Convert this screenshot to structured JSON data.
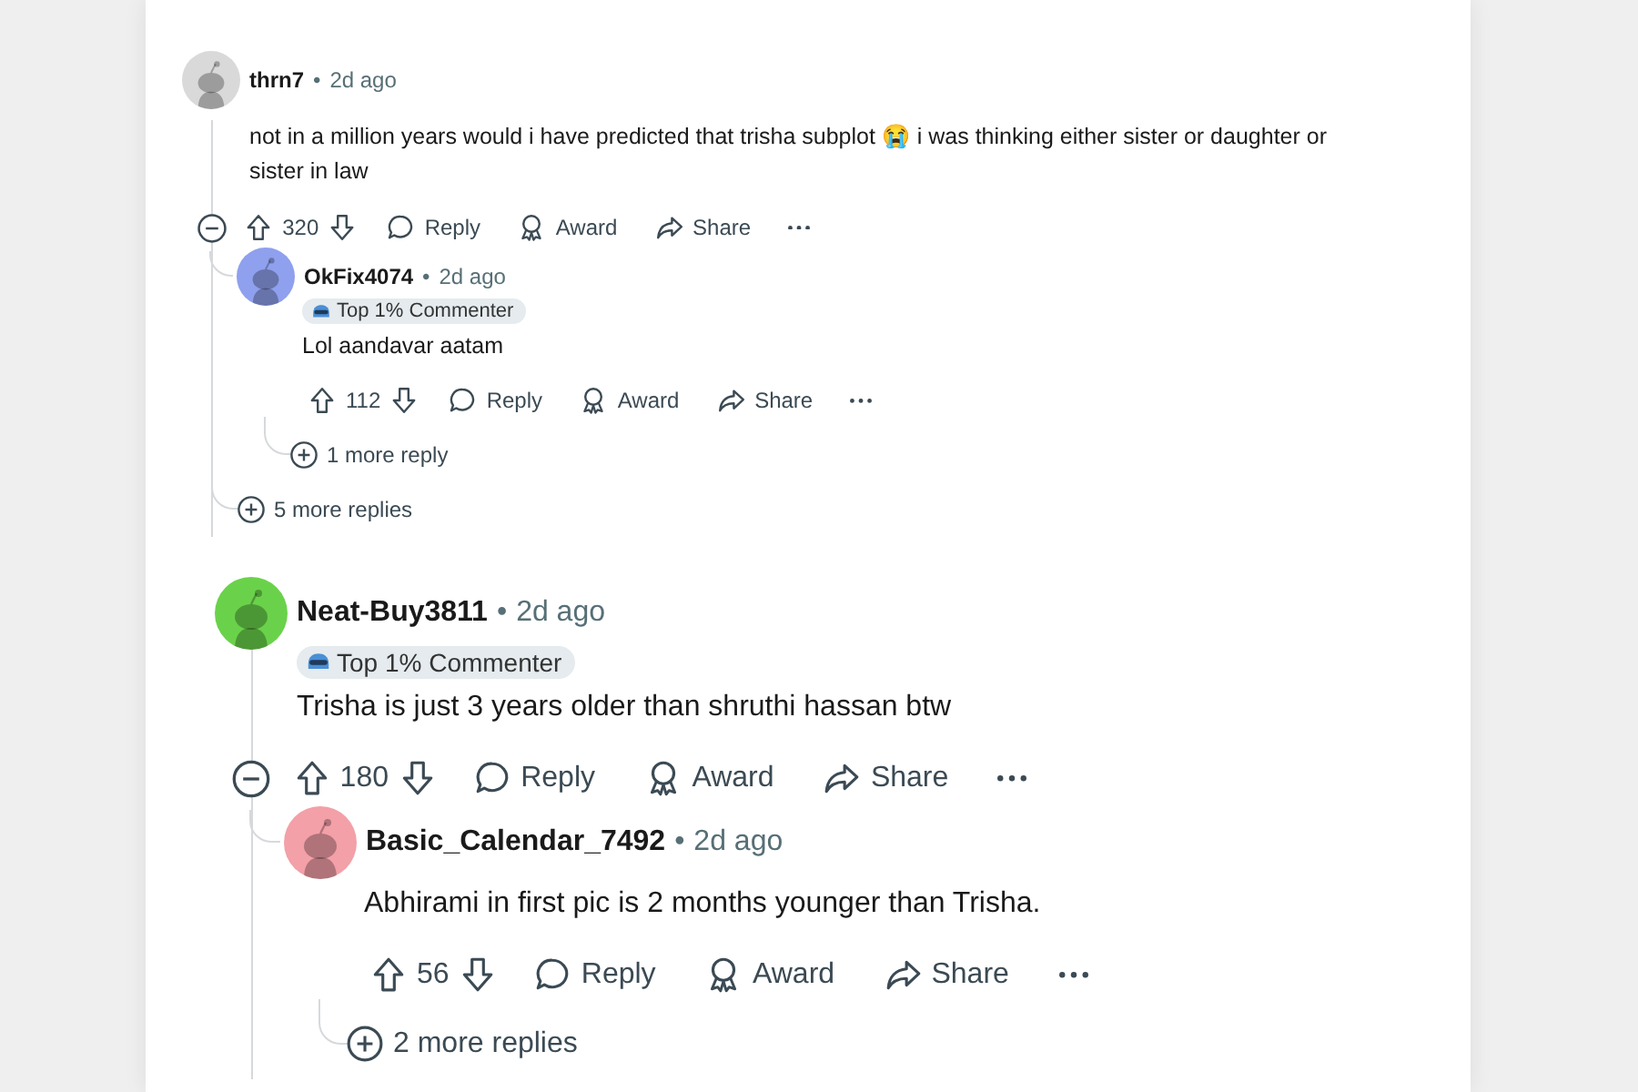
{
  "sections": [
    {
      "kind": "compact",
      "comments": [
        {
          "user": "thrn7",
          "dot": "•",
          "time": "2d ago",
          "color": "#d9d9d9",
          "body": "not in a million years would i have predicted that trisha subplot 😭 i was thinking either sister or daughter or sister in law",
          "votes": "320",
          "expanded": true,
          "actions": [
            {
              "kind": "reply",
              "label": "Reply"
            },
            {
              "kind": "award",
              "label": "Award"
            },
            {
              "kind": "share",
              "label": "Share"
            }
          ],
          "children": [
            {
              "user": "OkFix4074",
              "dot": "•",
              "time": "2d ago",
              "color": "#8fa0ee",
              "badge": "Top 1% Commenter",
              "body": "Lol aandavar aatam",
              "votes": "112",
              "expanded": false,
              "actions": [
                {
                  "kind": "reply",
                  "label": "Reply"
                },
                {
                  "kind": "award",
                  "label": "Award"
                },
                {
                  "kind": "share",
                  "label": "Share"
                }
              ],
              "more_replies": "1 more reply"
            }
          ],
          "more_replies": "5 more replies"
        }
      ]
    },
    {
      "kind": "large",
      "comments": [
        {
          "user": "Neat-Buy3811",
          "dot": "•",
          "time": "2d ago",
          "color": "#6ad24a",
          "badge": "Top 1% Commenter",
          "body": "Trisha is just 3 years older than shruthi hassan btw",
          "votes": "180",
          "expanded": true,
          "actions": [
            {
              "kind": "reply",
              "label": "Reply"
            },
            {
              "kind": "award",
              "label": "Award"
            },
            {
              "kind": "share",
              "label": "Share"
            }
          ],
          "children": [
            {
              "user": "Basic_Calendar_7492",
              "dot": "•",
              "time": "2d ago",
              "color": "#f3a0a8",
              "body": "Abhirami in first pic is 2 months younger than Trisha.",
              "votes": "56",
              "expanded": false,
              "actions": [
                {
                  "kind": "reply",
                  "label": "Reply"
                },
                {
                  "kind": "award",
                  "label": "Award"
                },
                {
                  "kind": "share",
                  "label": "Share"
                }
              ],
              "more_replies": "2 more replies"
            }
          ]
        }
      ]
    }
  ]
}
